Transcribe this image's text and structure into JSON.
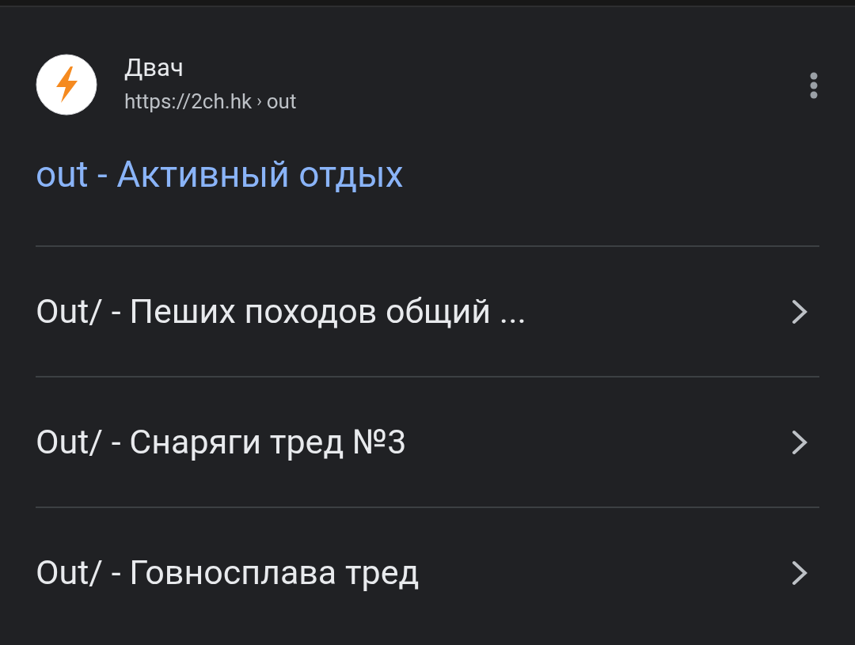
{
  "result": {
    "site_name": "Двач",
    "url": "https://2ch.hk",
    "breadcrumb_separator": "›",
    "breadcrumb": "out",
    "title": "out - Активный отдых"
  },
  "links": [
    {
      "label": "Out/ - Пеших походов общий ..."
    },
    {
      "label": "Out/ - Снаряги тред №3"
    },
    {
      "label": "Out/ - Говносплава тред"
    }
  ]
}
